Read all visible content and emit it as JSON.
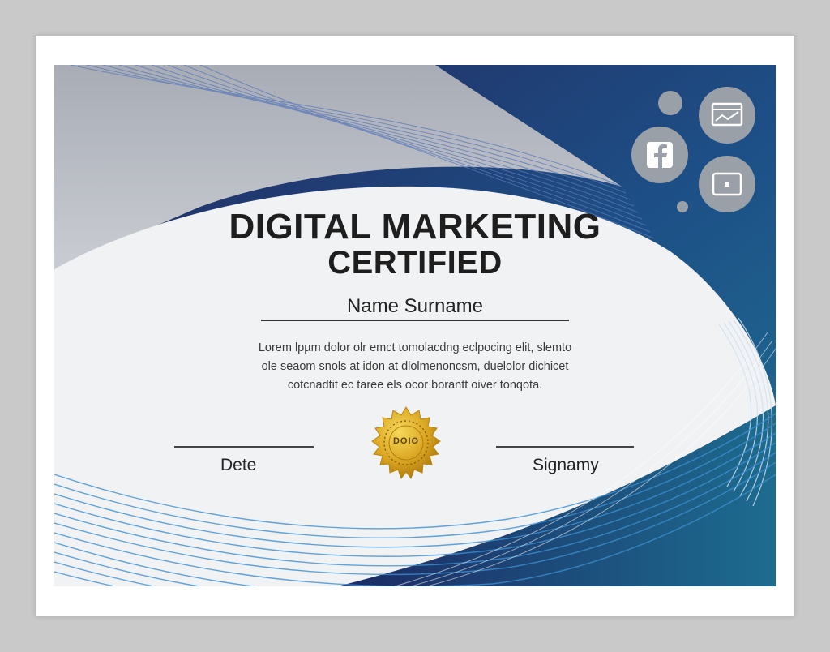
{
  "certificate": {
    "title_line1": "DIGITAL MARKETING",
    "title_line2": "CERTIFIED",
    "recipient": "Name Surname",
    "body_lines": [
      "Lorem lpµm dolor olr emct tomolacdng eclpocing elit, slemto",
      "ole seaom snols at idon at dlolmenoncsm, duelolor dichicet",
      "cotcnadtit ec taree els ocor borantt oiver tonqota."
    ],
    "date_label": "Dete",
    "signature_label": "Signamy",
    "seal_text": "DOIO"
  },
  "icons": [
    "facebook-icon",
    "chart-window-icon",
    "video-window-icon"
  ],
  "colors": {
    "navy": "#1c2a63",
    "teal": "#1d6f94",
    "wave_blue": "#3d8fd0",
    "gold": "#d7a21d",
    "icon_gray": "#9aa0a8"
  }
}
